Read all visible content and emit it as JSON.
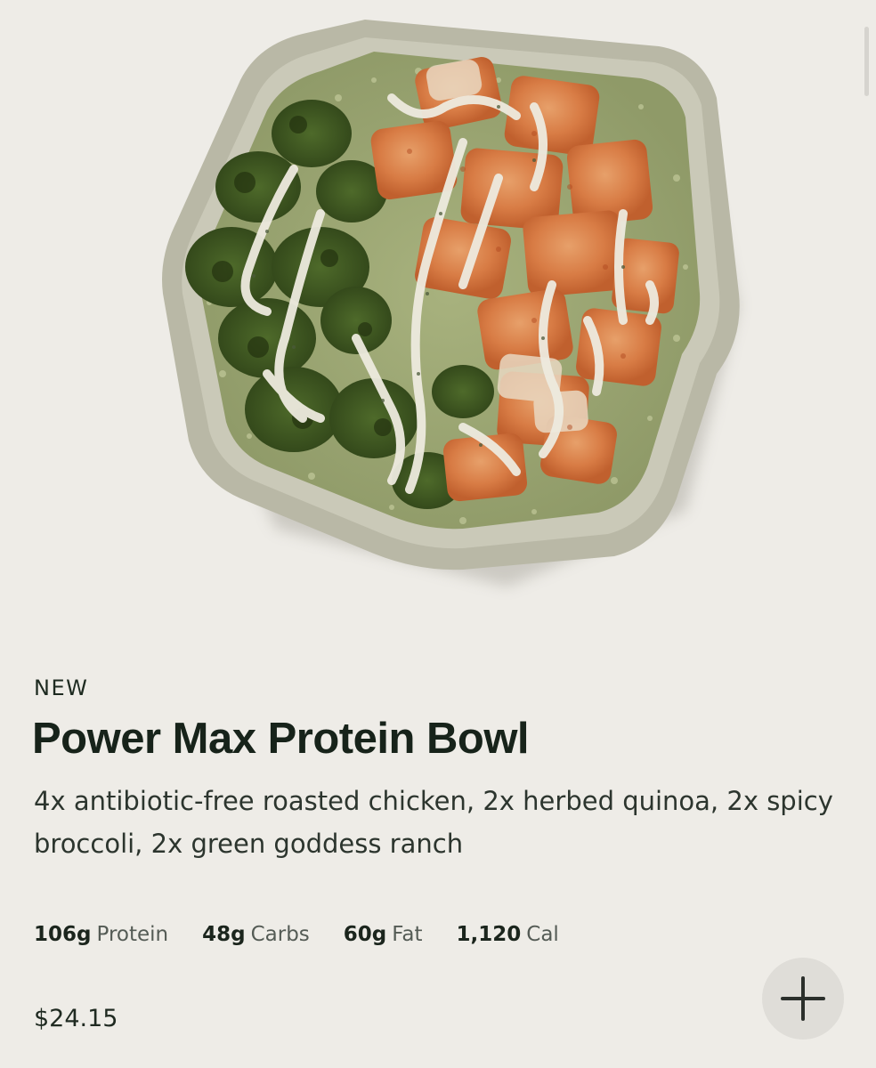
{
  "product": {
    "image_subject": "bowl with roasted chicken, herbed quinoa, spicy broccoli and green goddess ranch",
    "tag": "NEW",
    "name": "Power Max Protein Bowl",
    "description": "4x antibiotic-free roasted chicken, 2x herbed quinoa, 2x spicy broccoli, 2x green goddess ranch",
    "macros": [
      {
        "value": "106g",
        "label": "Protein"
      },
      {
        "value": "48g",
        "label": "Carbs"
      },
      {
        "value": "60g",
        "label": "Fat"
      },
      {
        "value": "1,120",
        "label": "Cal"
      }
    ],
    "price": "$24.15"
  },
  "actions": {
    "add_icon": "plus-icon"
  },
  "colors": {
    "background": "#eeece7",
    "button_background": "#dfddd8",
    "text_primary": "#17231a",
    "text_secondary": "#545b55"
  }
}
